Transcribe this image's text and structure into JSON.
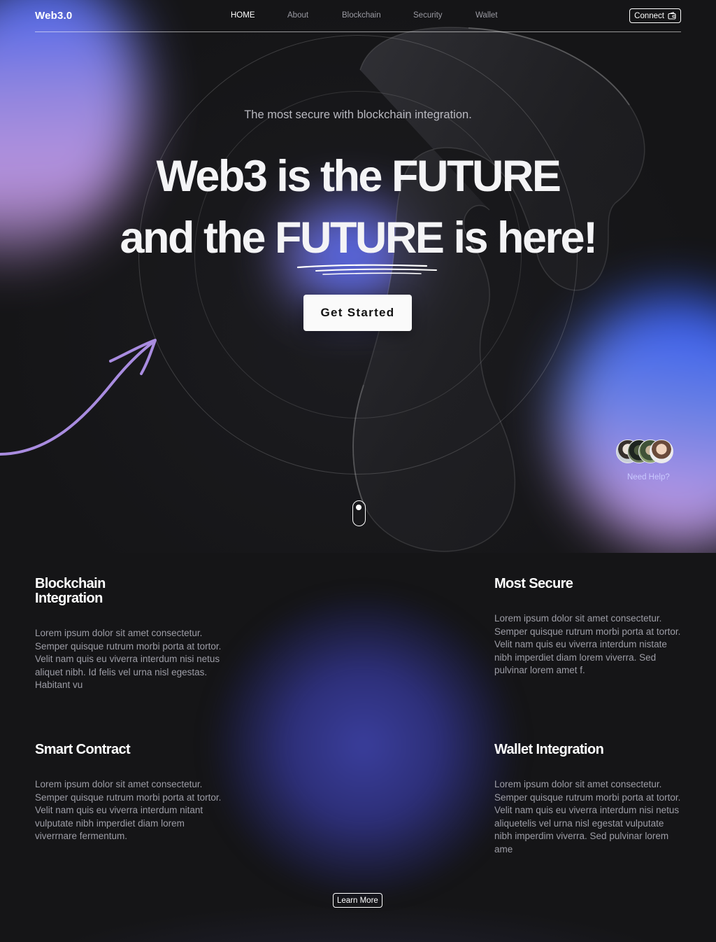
{
  "nav": {
    "logo": "Web3.0",
    "links": [
      "HOME",
      "About",
      "Blockchain",
      "Security",
      "Wallet"
    ],
    "active": "HOME",
    "connect_label": "Connect"
  },
  "hero": {
    "tagline": "The most secure with blockchain integration.",
    "headline_line1": "Web3 is the FUTURE",
    "headline_line2": "and the FUTURE is here!",
    "cta_label": "Get Started",
    "accent_color": "#a98ce0"
  },
  "help": {
    "label": "Need Help?"
  },
  "features": [
    {
      "title": "Blockchain Integration",
      "body": "Lorem ipsum dolor sit amet consectetur. Semper quisque rutrum morbi porta at tortor. Velit nam quis eu viverra interdum nisi netus aliquet nibh. Id felis vel urna nisl egestas. Habitant vu"
    },
    {
      "title": "Most Secure",
      "body": "Lorem ipsum dolor sit amet consectetur. Semper quisque rutrum morbi porta at tortor. Velit nam quis eu viverra interdum nistate nibh imperdiet diam lorem viverra. Sed pulvinar lorem amet f."
    },
    {
      "title": "Smart Contract",
      "body": "Lorem ipsum dolor sit amet consectetur. Semper quisque rutrum morbi porta at tortor. Velit nam quis eu viverra interdum nitant vulputate nibh imperdiet diam lorem viverrnare fermentum."
    },
    {
      "title": "Wallet Integration",
      "body": "Lorem ipsum dolor sit amet consectetur. Semper quisque rutrum morbi porta at tortor. Velit nam quis eu viverra interdum nisi netus aliquetelis vel urna nisl egestat vulputate nibh imperdim viverra. Sed pulvinar lorem ame"
    }
  ],
  "learn_more_label": "Learn More"
}
